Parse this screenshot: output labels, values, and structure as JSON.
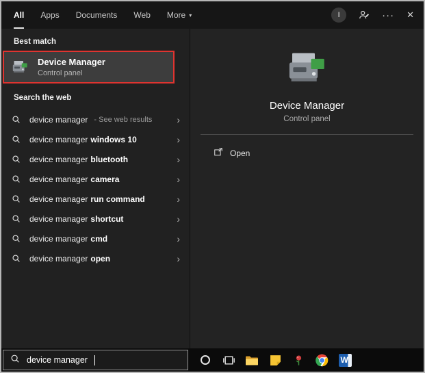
{
  "header": {
    "tabs": [
      {
        "label": "All",
        "active": true
      },
      {
        "label": "Apps",
        "active": false
      },
      {
        "label": "Documents",
        "active": false
      },
      {
        "label": "Web",
        "active": false
      },
      {
        "label": "More",
        "active": false,
        "has_dropdown": true
      }
    ],
    "more_caret": "▾",
    "avatar_initial": "I",
    "ellipsis_label": "···",
    "close_label": "✕"
  },
  "left_panel": {
    "best_match_header": "Best match",
    "best_match": {
      "title": "Device Manager",
      "subtitle": "Control panel",
      "annotated_with_red_box": true
    },
    "web_header": "Search the web",
    "chevron": "›",
    "suggestions": [
      {
        "text": "device manager",
        "bold": "",
        "note": "- See web results"
      },
      {
        "text": "device manager",
        "bold": "windows 10",
        "note": ""
      },
      {
        "text": "device manager",
        "bold": "bluetooth",
        "note": ""
      },
      {
        "text": "device manager",
        "bold": "camera",
        "note": ""
      },
      {
        "text": "device manager",
        "bold": "run command",
        "note": ""
      },
      {
        "text": "device manager",
        "bold": "shortcut",
        "note": ""
      },
      {
        "text": "device manager",
        "bold": "cmd",
        "note": ""
      },
      {
        "text": "device manager",
        "bold": "open",
        "note": ""
      }
    ]
  },
  "preview_panel": {
    "title": "Device Manager",
    "subtitle": "Control panel",
    "actions": [
      {
        "label": "Open",
        "icon": "open-window-icon"
      }
    ]
  },
  "search_bar": {
    "value": "device manager",
    "icon": "search-icon"
  },
  "taskbar": {
    "icons": [
      "cortana-circle-icon",
      "task-view-icon",
      "file-explorer-icon",
      "sticky-notes-icon",
      "flower-icon",
      "chrome-icon",
      "word-icon"
    ],
    "word_letter": "W"
  },
  "colors": {
    "panel_bg": "#212121",
    "preview_bg": "#232323",
    "topbar_bg": "#161616",
    "highlight_bg": "#3d3d3d",
    "annotation_red": "#df3430",
    "taskbar_bg": "#0b0b0b",
    "primary_text": "#ffffff",
    "secondary_text": "#b5b5b5"
  }
}
